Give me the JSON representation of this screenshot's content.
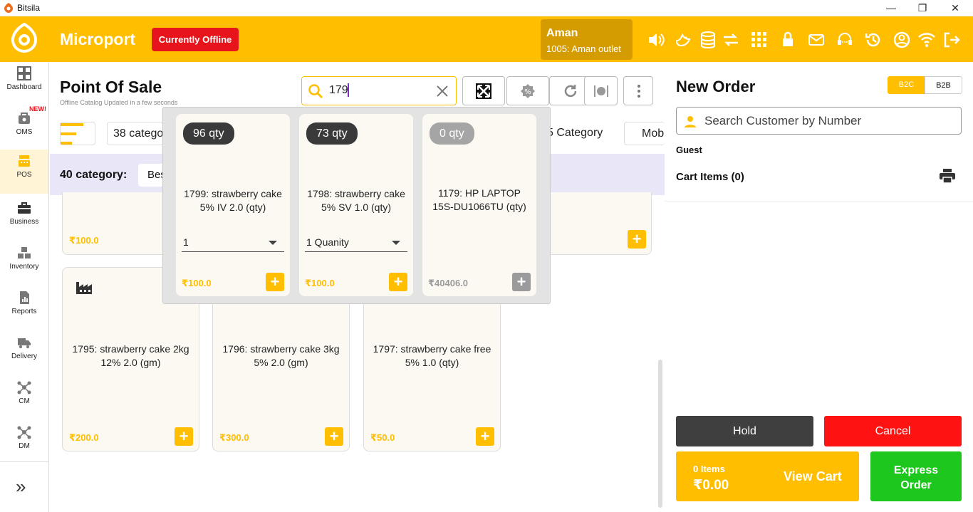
{
  "window": {
    "title": "Bitsila",
    "minimize": "—",
    "maximize": "❐",
    "close": "✕"
  },
  "header": {
    "brand": "Microport",
    "status": "Currently Offline",
    "user_name": "Aman",
    "outlet": "1005: Aman outlet",
    "icons": [
      "volume-icon",
      "bird-icon",
      "database-icon",
      "sync-icon",
      "grid-icon",
      "lock-icon",
      "mail-icon",
      "support-icon",
      "history-icon",
      "user-icon",
      "wifi-icon",
      "logout-icon"
    ]
  },
  "sidebar": {
    "items": [
      {
        "label": "Dashboard",
        "icon": "dashboard-icon"
      },
      {
        "label": "OMS",
        "icon": "oms-icon",
        "badge": "NEW!"
      },
      {
        "label": "POS",
        "icon": "pos-icon",
        "active": true
      },
      {
        "label": "Business",
        "icon": "briefcase-icon"
      },
      {
        "label": "Inventory",
        "icon": "boxes-icon"
      },
      {
        "label": "Reports",
        "icon": "report-icon"
      },
      {
        "label": "Delivery",
        "icon": "truck-icon"
      },
      {
        "label": "CM",
        "icon": "network-icon"
      },
      {
        "label": "DM",
        "icon": "network-icon"
      }
    ],
    "expand_icon": "»"
  },
  "main": {
    "title": "Point Of Sale",
    "subtitle": "Offline Catalog Updated in a few seconds",
    "search": {
      "value": "179"
    },
    "filters": [
      "38 catego",
      "5 Category",
      "Mob"
    ],
    "category_label": "40 category:",
    "category_chip": "Best",
    "products": [
      {
        "name": "",
        "price": "₹100.0"
      },
      {
        "name": "",
        "price": ""
      },
      {
        "name": "1795: strawberry cake 2kg 12% 2.0 (gm)",
        "price": "₹200.0"
      },
      {
        "name": "1796: strawberry cake 3kg 5% 2.0 (gm)",
        "price": "₹300.0"
      },
      {
        "name": "1797: strawberry cake free 5% 1.0 (qty)",
        "price": "₹50.0"
      }
    ]
  },
  "popup": {
    "results": [
      {
        "qty": "96 qty",
        "name": "1799: strawberry cake 5% IV 2.0 (qty)",
        "select": "1",
        "price": "₹100.0"
      },
      {
        "qty": "73 qty",
        "name": "1798: strawberry cake 5% SV 1.0 (qty)",
        "select": "1 Quanity",
        "price": "₹100.0"
      },
      {
        "qty": "0 qty",
        "name": "1179: HP LAPTOP 15S-DU1066TU  (qty)",
        "select": "",
        "price": "₹40406.0"
      }
    ]
  },
  "order": {
    "title": "New Order",
    "seg_b2c": "B2C",
    "seg_b2b": "B2B",
    "customer_placeholder": "Search Customer by Number",
    "guest": "Guest",
    "cart_label": "Cart Items (0)",
    "hold": "Hold",
    "cancel": "Cancel",
    "items_count": "0 Items",
    "total": "₹0.00",
    "view_cart": "View Cart",
    "express": "Express Order"
  },
  "colors": {
    "accent": "#FFBE00",
    "danger": "#E8141B",
    "success": "#1DC71D"
  }
}
